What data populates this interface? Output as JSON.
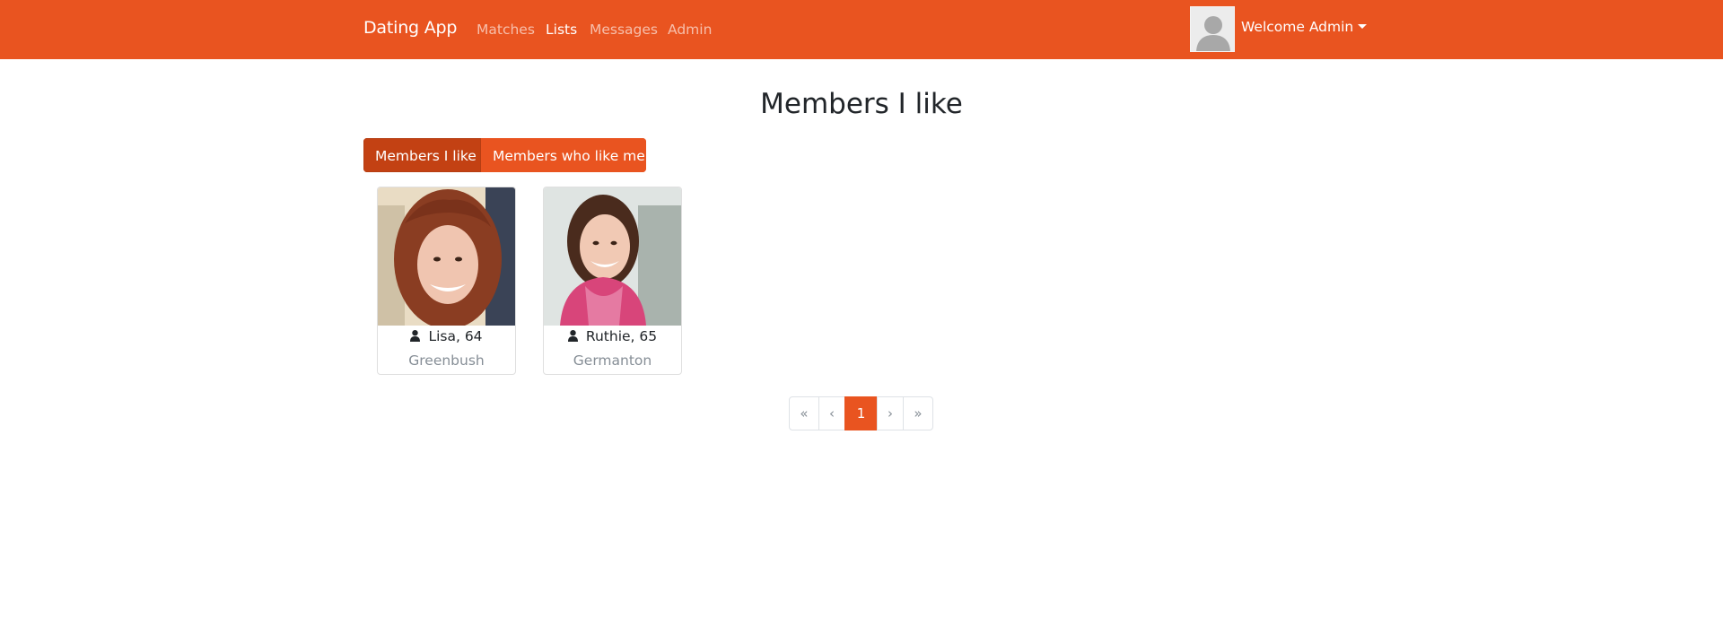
{
  "navbar": {
    "brand": "Dating App",
    "links": [
      {
        "label": "Matches",
        "active": false
      },
      {
        "label": "Lists",
        "active": true
      },
      {
        "label": "Messages",
        "active": false
      },
      {
        "label": "Admin",
        "active": false
      }
    ],
    "welcome": "Welcome Admin",
    "avatar_icon": "user-avatar-placeholder"
  },
  "page": {
    "title": "Members I like"
  },
  "tabs": [
    {
      "label": "Members I like",
      "active": true
    },
    {
      "label": "Members who like me",
      "active": false
    }
  ],
  "members": [
    {
      "name_age": "Lisa, 64",
      "city": "Greenbush",
      "icon": "user-icon"
    },
    {
      "name_age": "Ruthie, 65",
      "city": "Germanton",
      "icon": "user-icon"
    }
  ],
  "pagination": {
    "first": "«",
    "prev": "‹",
    "current": "1",
    "next": "›",
    "last": "»"
  },
  "colors": {
    "brand": "#e95420",
    "active_tab": "#c34113",
    "muted_text": "#868e96"
  }
}
